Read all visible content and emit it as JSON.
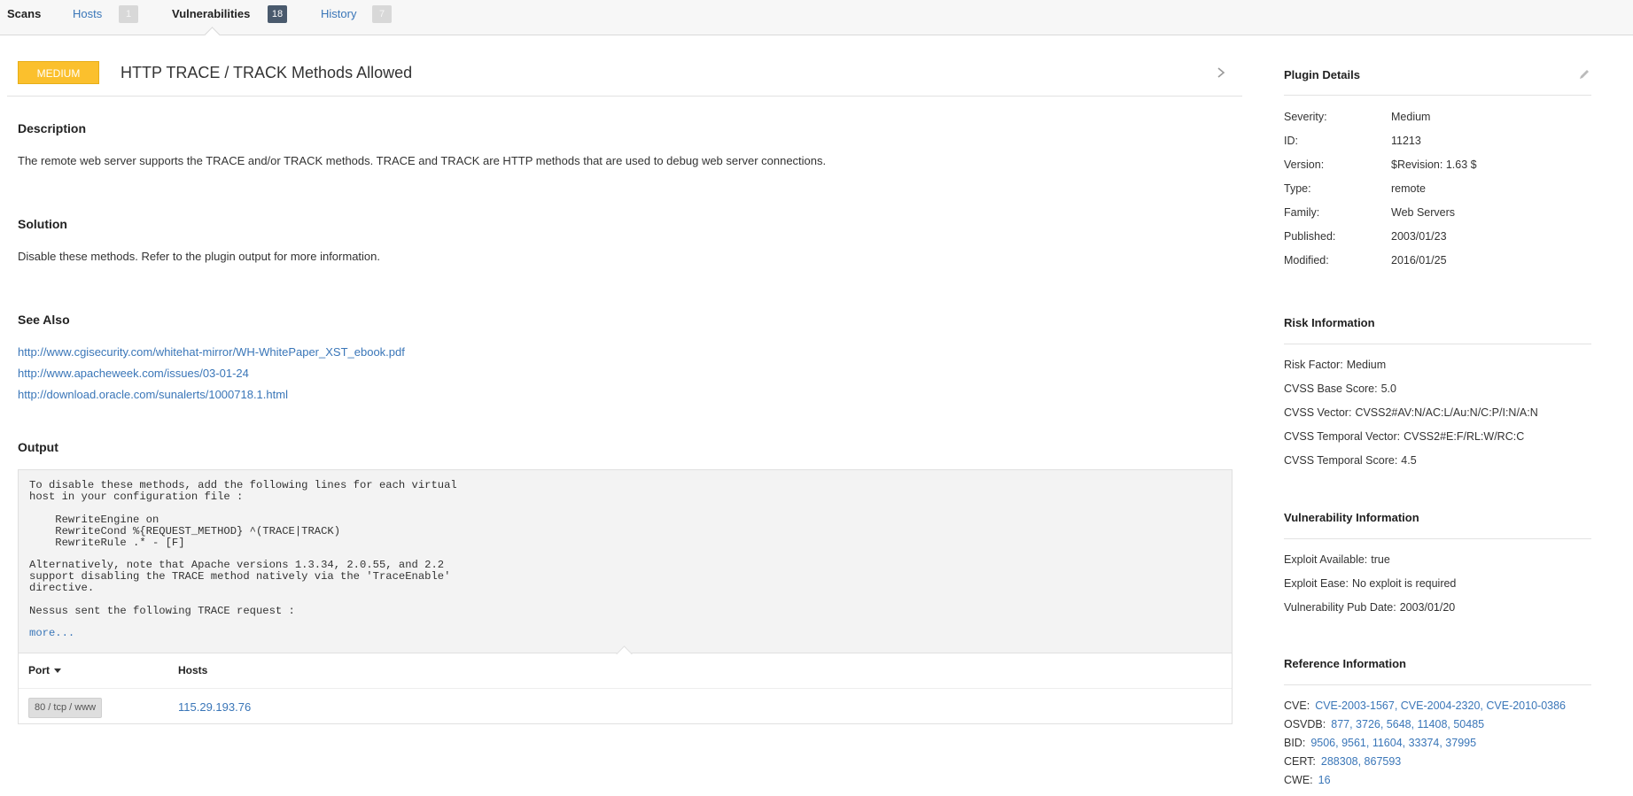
{
  "nav": {
    "scans": "Scans",
    "hosts": "Hosts",
    "hosts_count": "1",
    "vulnerabilities": "Vulnerabilities",
    "vulnerabilities_count": "18",
    "history": "History",
    "history_count": "7"
  },
  "vuln": {
    "severity": "MEDIUM",
    "title": "HTTP TRACE / TRACK Methods Allowed"
  },
  "description": {
    "heading": "Description",
    "text": "The remote web server supports the TRACE and/or TRACK methods. TRACE and TRACK are HTTP methods that are used to debug web server connections."
  },
  "solution": {
    "heading": "Solution",
    "text": "Disable these methods. Refer to the plugin output for more information."
  },
  "see_also": {
    "heading": "See Also",
    "links": [
      "http://www.cgisecurity.com/whitehat-mirror/WH-WhitePaper_XST_ebook.pdf",
      "http://www.apacheweek.com/issues/03-01-24",
      "http://download.oracle.com/sunalerts/1000718.1.html"
    ]
  },
  "output": {
    "heading": "Output",
    "text": "To disable these methods, add the following lines for each virtual\nhost in your configuration file :\n\n    RewriteEngine on\n    RewriteCond %{REQUEST_METHOD} ^(TRACE|TRACK)\n    RewriteRule .* - [F]\n\nAlternatively, note that Apache versions 1.3.34, 2.0.55, and 2.2\nsupport disabling the TRACE method natively via the 'TraceEnable'\ndirective.\n\nNessus sent the following TRACE request :",
    "more": "more..."
  },
  "table": {
    "col_port": "Port",
    "col_hosts": "Hosts",
    "rows": [
      {
        "port": "80 / tcp / www",
        "host": "115.29.193.76"
      }
    ]
  },
  "plugin_details": {
    "heading": "Plugin Details",
    "items": [
      {
        "k": "Severity:",
        "v": "Medium"
      },
      {
        "k": "ID:",
        "v": "11213"
      },
      {
        "k": "Version:",
        "v": "$Revision: 1.63 $"
      },
      {
        "k": "Type:",
        "v": "remote"
      },
      {
        "k": "Family:",
        "v": "Web Servers"
      },
      {
        "k": "Published:",
        "v": "2003/01/23"
      },
      {
        "k": "Modified:",
        "v": "2016/01/25"
      }
    ]
  },
  "risk_info": {
    "heading": "Risk Information",
    "items": [
      {
        "k": "Risk Factor:",
        "v": "Medium"
      },
      {
        "k": "CVSS Base Score:",
        "v": "5.0"
      },
      {
        "k": "CVSS Vector:",
        "v": "CVSS2#AV:N/AC:L/Au:N/C:P/I:N/A:N"
      },
      {
        "k": "CVSS Temporal Vector:",
        "v": "CVSS2#E:F/RL:W/RC:C"
      },
      {
        "k": "CVSS Temporal Score:",
        "v": "4.5"
      }
    ]
  },
  "vuln_info": {
    "heading": "Vulnerability Information",
    "items": [
      {
        "k": "Exploit Available:",
        "v": "true"
      },
      {
        "k": "Exploit Ease:",
        "v": "No exploit is required"
      },
      {
        "k": "Vulnerability Pub Date:",
        "v": "2003/01/20"
      }
    ]
  },
  "ref_info": {
    "heading": "Reference Information",
    "items": [
      {
        "k": "CVE:",
        "v": "CVE-2003-1567, CVE-2004-2320, CVE-2010-0386"
      },
      {
        "k": "OSVDB:",
        "v": "877, 3726, 5648, 11408, 50485"
      },
      {
        "k": "BID:",
        "v": "9506, 9561, 11604, 33374, 37995"
      },
      {
        "k": "CERT:",
        "v": "288308, 867593"
      },
      {
        "k": "CWE:",
        "v": "16"
      }
    ]
  },
  "colors": {
    "severity_medium": "#fbc02d",
    "link": "#3a76b8",
    "active_badge": "#4a5a6d"
  }
}
